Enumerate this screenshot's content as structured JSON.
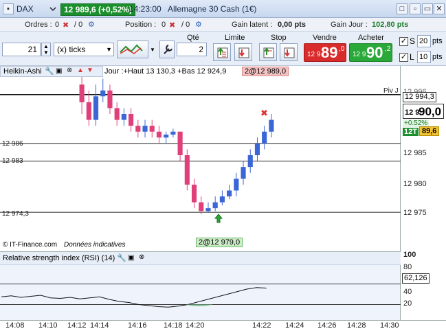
{
  "window": {
    "instrument": "DAX",
    "price_badge": "12 989,6 (+0,52%)",
    "time": "14:23:00",
    "name": "Allemagne 30 Cash (1€)"
  },
  "info": {
    "ordres_label": "Ordres :",
    "ordres_val": "0",
    "ordres_val2": "/ 0",
    "position_label": "Position :",
    "position_val": "0",
    "position_val2": "/ 0",
    "gain_latent_label": "Gain latent :",
    "gain_latent_val": "0,00 pts",
    "gain_jour_label": "Gain Jour :",
    "gain_jour_val": "102,80 pts"
  },
  "controls": {
    "qty_field": "21",
    "unit_select": "(x) ticks",
    "qte_label": "Qté",
    "qte_value": "2",
    "limite_label": "Limite",
    "stop_label": "Stop",
    "vendre_label": "Vendre",
    "acheter_label": "Acheter",
    "sell_prefix": "12 9",
    "sell_big": "89",
    "sell_sup": ",0",
    "buy_prefix": "12 9",
    "buy_big": "90",
    "buy_sup": ",2",
    "s_label": "S",
    "s_value": "20",
    "s_unit": "pts",
    "l_label": "L",
    "l_value": "10",
    "l_unit": "pts"
  },
  "chart": {
    "indicator": "Heikin-Ashi",
    "legend": "Jour :+Haut 13 130,3 +Bas 12 924,9",
    "order_top": "2@12 989,0",
    "order_bottom": "2@12 979,0",
    "copyright": "© IT-Finance.com",
    "disclaimer": "Données indicatives",
    "piv_label": "Piv J",
    "piv_value": "12 994,3",
    "last_prefix": "12 9",
    "last_big": "90,0",
    "change": "+0.52%",
    "ticker_small": "12T",
    "volume_box": "89,6",
    "level1": "12 986",
    "level2": "12 983",
    "level3": "12 974,3",
    "y_ticks": [
      "12 985",
      "12 980",
      "12 975"
    ],
    "y_top": "12 996"
  },
  "rsi": {
    "title": "Relative strength index (RSI) (14)",
    "value": "62,126",
    "ticks": [
      "100",
      "80",
      "40",
      "20"
    ]
  },
  "time_axis": [
    "14:08",
    "14:10",
    "14:12",
    "14:14",
    "14:16",
    "14:18",
    "14:20",
    "14:22",
    "14:24",
    "14:26",
    "14:28",
    "14:30"
  ],
  "colors": {
    "up": "#3b66d6",
    "down": "#e0407a",
    "sell": "#d92b2b",
    "buy": "#2aa83a"
  },
  "chart_data": {
    "type": "candlestick",
    "candles": [
      {
        "o": 12996,
        "c": 12993,
        "h": 12998,
        "l": 12991
      },
      {
        "o": 12993,
        "c": 12990,
        "h": 12995,
        "l": 12989
      },
      {
        "o": 12990,
        "c": 12994,
        "h": 12996,
        "l": 12989
      },
      {
        "o": 12994,
        "c": 12995,
        "h": 12997,
        "l": 12993
      },
      {
        "o": 12995,
        "c": 12992,
        "h": 12996,
        "l": 12991
      },
      {
        "o": 12992,
        "c": 12990,
        "h": 12993,
        "l": 12989
      },
      {
        "o": 12990,
        "c": 12991,
        "h": 12992,
        "l": 12989
      },
      {
        "o": 12991,
        "c": 12989,
        "h": 12992,
        "l": 12988
      },
      {
        "o": 12989,
        "c": 12988,
        "h": 12990,
        "l": 12987
      },
      {
        "o": 12988,
        "c": 12989,
        "h": 12990,
        "l": 12987
      },
      {
        "o": 12989,
        "c": 12988,
        "h": 12990,
        "l": 12987
      },
      {
        "o": 12988,
        "c": 12987,
        "h": 12989,
        "l": 12986
      },
      {
        "o": 12987,
        "c": 12987.5,
        "h": 12988,
        "l": 12986
      },
      {
        "o": 12987.5,
        "c": 12988,
        "h": 12988.5,
        "l": 12987
      },
      {
        "o": 12988,
        "c": 12984,
        "h": 12988,
        "l": 12983
      },
      {
        "o": 12984,
        "c": 12979,
        "h": 12985,
        "l": 12978
      },
      {
        "o": 12979,
        "c": 12976,
        "h": 12980,
        "l": 12975
      },
      {
        "o": 12976,
        "c": 12974.5,
        "h": 12977,
        "l": 12974
      },
      {
        "o": 12974.5,
        "c": 12975,
        "h": 12976,
        "l": 12974.3
      },
      {
        "o": 12975,
        "c": 12976,
        "h": 12977,
        "l": 12974.5
      },
      {
        "o": 12976,
        "c": 12977,
        "h": 12978,
        "l": 12975.5
      },
      {
        "o": 12977,
        "c": 12978,
        "h": 12979,
        "l": 12976.5
      },
      {
        "o": 12978,
        "c": 12980,
        "h": 12981,
        "l": 12977
      },
      {
        "o": 12980,
        "c": 12982,
        "h": 12983,
        "l": 12979
      },
      {
        "o": 12982,
        "c": 12984,
        "h": 12985,
        "l": 12981
      },
      {
        "o": 12984,
        "c": 12986,
        "h": 12987,
        "l": 12983
      },
      {
        "o": 12986,
        "c": 12988,
        "h": 12989,
        "l": 12985
      },
      {
        "o": 12988,
        "c": 12990,
        "h": 12991,
        "l": 12987
      }
    ],
    "rsi": [
      45,
      47,
      44,
      46,
      48,
      43,
      42,
      44,
      41,
      43,
      45,
      40,
      36,
      34,
      30,
      28,
      26,
      25,
      27,
      30,
      35,
      40,
      45,
      50,
      55,
      60,
      63,
      62
    ]
  }
}
